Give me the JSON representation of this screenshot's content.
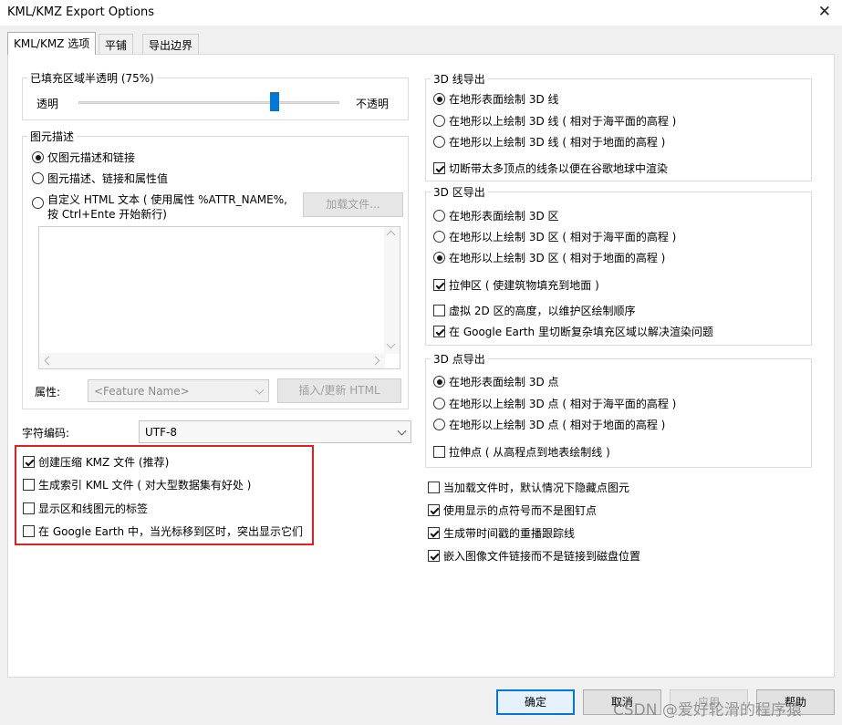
{
  "window": {
    "title": "KML/KMZ Export Options",
    "close_glyph": "✕"
  },
  "tabs": [
    {
      "label": "KML/KMZ 选项",
      "active": true
    },
    {
      "label": "平铺",
      "active": false
    },
    {
      "label": "导出边界",
      "active": false
    }
  ],
  "fill_opacity": {
    "group_label": "已填充区域半透明 (75%)",
    "left_label": "透明",
    "right_label": "不透明",
    "value_percent": 75
  },
  "feature_desc": {
    "group_label": "图元描述",
    "options": [
      {
        "label": "仅图元描述和链接",
        "selected": true
      },
      {
        "label": "图元描述、链接和属性值",
        "selected": false
      }
    ],
    "custom_html_line1": "自定义 HTML 文本 ( 使用属性 %ATTR_NAME%,",
    "custom_html_line2": "按 Ctrl+Ente 开始新行)",
    "load_file_button": "加载文件...",
    "attribute_label": "属性:",
    "attribute_placeholder": "<Feature Name>",
    "insert_button": "插入/更新 HTML"
  },
  "encoding": {
    "label": "字符编码:",
    "value": "UTF-8"
  },
  "kmz_options": [
    {
      "label": "创建压缩 KMZ 文件 (推荐)",
      "checked": true
    },
    {
      "label": "生成索引 KML 文件 ( 对大型数据集有好处 )",
      "checked": false
    },
    {
      "label": "显示区和线图元的标签",
      "checked": false
    },
    {
      "label": "在 Google Earth 中，当光标移到区时，突出显示它们",
      "checked": false
    }
  ],
  "line_export": {
    "group_label": "3D 线导出",
    "options": [
      {
        "label": "在地形表面绘制 3D 线",
        "selected": true
      },
      {
        "label": "在地形以上绘制 3D 线 ( 相对于海平面的高程 )",
        "selected": false
      },
      {
        "label": "在地形以上绘制 3D 线 ( 相对于地面的高程 )",
        "selected": false
      }
    ],
    "checkbox": {
      "label": "切断带太多顶点的线条以便在谷歌地球中渲染",
      "checked": true
    }
  },
  "area_export": {
    "group_label": "3D 区导出",
    "options": [
      {
        "label": "在地形表面绘制 3D 区",
        "selected": false
      },
      {
        "label": "在地形以上绘制 3D 区 ( 相对于海平面的高程 )",
        "selected": false
      },
      {
        "label": "在地形以上绘制 3D 区 ( 相对于地面的高程 )",
        "selected": true
      }
    ],
    "checkboxes": [
      {
        "label": "拉伸区 ( 使建筑物填充到地面 )",
        "checked": true
      },
      {
        "label": "虚拟 2D 区的高度，以维护区绘制顺序",
        "checked": false
      },
      {
        "label": "在 Google Earth 里切断复杂填充区域以解决渲染问题",
        "checked": true
      }
    ]
  },
  "point_export": {
    "group_label": "3D 点导出",
    "options": [
      {
        "label": "在地形表面绘制 3D 点",
        "selected": true
      },
      {
        "label": "在地形以上绘制 3D 点 ( 相对于海平面的高程 )",
        "selected": false
      },
      {
        "label": "在地形以上绘制 3D 点 ( 相对于地面的高程 )",
        "selected": false
      }
    ],
    "checkbox": {
      "label": "拉伸点 ( 从高程点到地表绘制线 )",
      "checked": false
    }
  },
  "misc_options": [
    {
      "label": "当加载文件时，默认情况下隐藏点图元",
      "checked": false
    },
    {
      "label": "使用显示的点符号而不是图钉点",
      "checked": true
    },
    {
      "label": "生成带时间戳的重播跟踪线",
      "checked": true
    },
    {
      "label": "嵌入图像文件链接而不是链接到磁盘位置",
      "checked": true
    }
  ],
  "footer": {
    "ok": "确定",
    "cancel": "取消",
    "apply": "应用",
    "help": "帮助",
    "watermark": "CSDN @爱好轮滑的程序猿"
  },
  "colors": {
    "accent": "#0078d7",
    "highlight_box": "#e02020",
    "slider_thumb": "#0078d7"
  }
}
